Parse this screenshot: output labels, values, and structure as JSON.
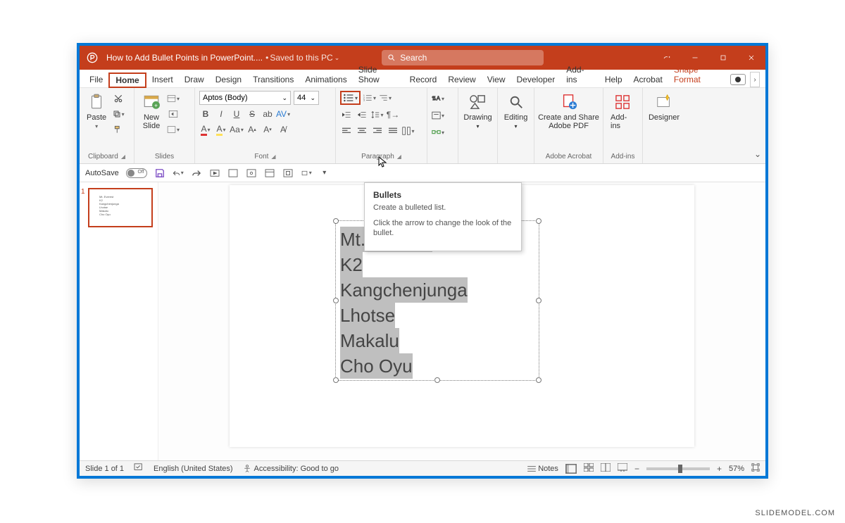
{
  "titlebar": {
    "doc_title": "How to Add Bullet Points in PowerPoint....",
    "saved_text": "Saved to this PC",
    "search_placeholder": "Search"
  },
  "tabs": {
    "file": "File",
    "home": "Home",
    "insert": "Insert",
    "draw": "Draw",
    "design": "Design",
    "transitions": "Transitions",
    "animations": "Animations",
    "slideshow": "Slide Show",
    "record": "Record",
    "review": "Review",
    "view": "View",
    "developer": "Developer",
    "addins": "Add-ins",
    "help": "Help",
    "acrobat": "Acrobat",
    "shape_format": "Shape Format"
  },
  "ribbon": {
    "clipboard": {
      "paste": "Paste",
      "label": "Clipboard"
    },
    "slides": {
      "new_slide": "New\nSlide",
      "label": "Slides"
    },
    "font": {
      "name": "Aptos (Body)",
      "size": "44",
      "label": "Font",
      "aa": "Aa",
      "bigA": "A",
      "smallA": "A"
    },
    "paragraph": {
      "label": "Paragraph"
    },
    "drawing": {
      "label": "Drawing",
      "btn": "Drawing"
    },
    "editing": {
      "btn": "Editing"
    },
    "acrobat": {
      "btn": "Create and Share\nAdobe PDF",
      "label": "Adobe Acrobat"
    },
    "addins_grp": {
      "btn": "Add-ins",
      "label": "Add-ins"
    },
    "designer": {
      "btn": "Designer"
    }
  },
  "qat": {
    "autosave": "AutoSave"
  },
  "tooltip": {
    "title": "Bullets",
    "line1": "Create a bulleted list.",
    "line2": "Click the arrow to change the look of the bullet."
  },
  "thumb": {
    "num": "1"
  },
  "slide_text": {
    "l1": "Mt. Everest",
    "l2": "K2",
    "l3": "Kangchenjunga",
    "l4": "Lhotse",
    "l5": "Makalu",
    "l6": "Cho Oyu"
  },
  "status": {
    "slide": "Slide 1 of 1",
    "lang": "English (United States)",
    "access": "Accessibility: Good to go",
    "notes": "Notes",
    "zoom": "57%"
  },
  "watermark": "SLIDEMODEL.COM"
}
